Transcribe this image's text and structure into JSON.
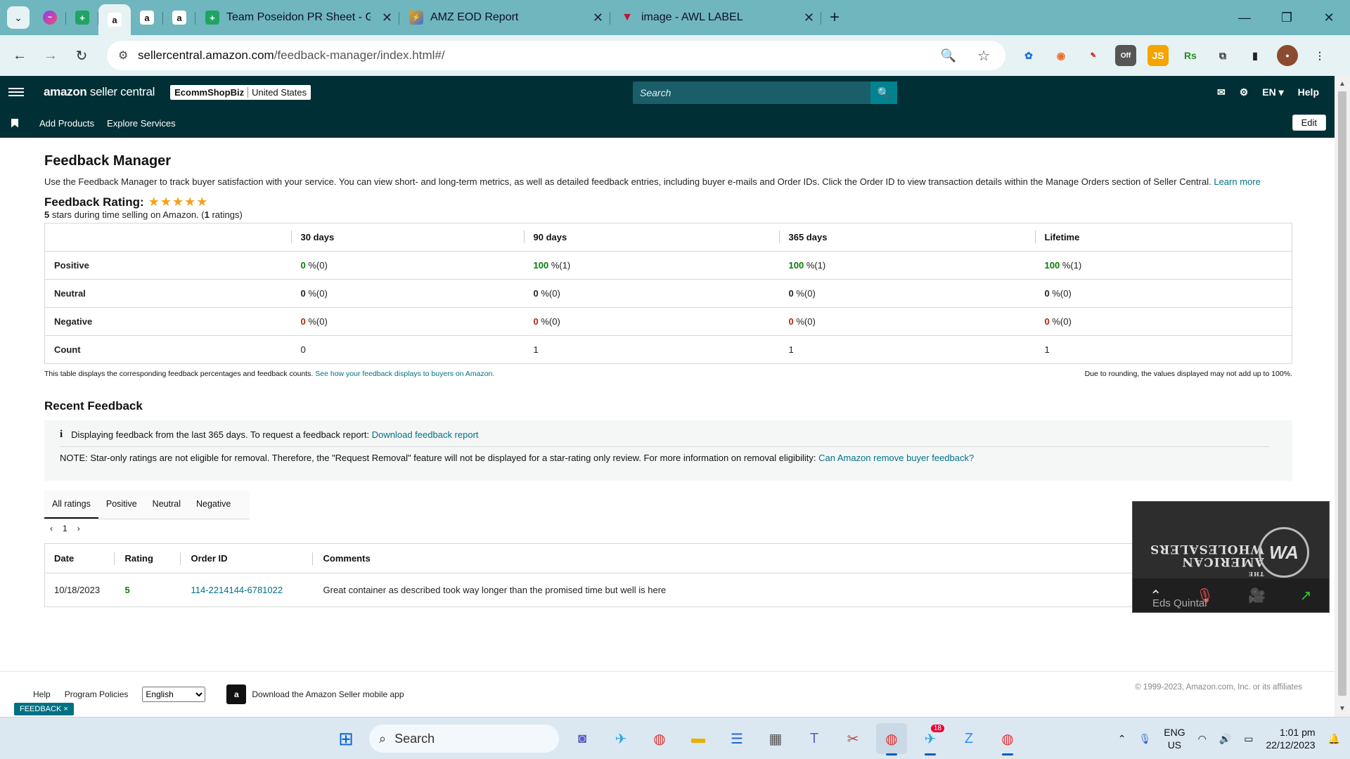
{
  "browser": {
    "tabs": [
      {
        "title": "Team Poseidon PR Sheet - Goo",
        "icon": "sheets-icon"
      },
      {
        "title": "AMZ EOD Report",
        "icon": "report-icon"
      },
      {
        "title": "image - AWL LABEL",
        "icon": "awl-icon"
      }
    ],
    "url_domain": "sellercentral.amazon.com",
    "url_path": "/feedback-manager/index.html#/"
  },
  "header": {
    "logo_bold": "amazon",
    "logo_rest": " seller central",
    "store_name": "EcommShopBiz",
    "store_region": "United States",
    "search_placeholder": "Search",
    "lang": "EN",
    "help": "Help"
  },
  "subnav": {
    "items": [
      "Add Products",
      "Explore Services"
    ],
    "edit": "Edit"
  },
  "page": {
    "title": "Feedback Manager",
    "intro": "Use the Feedback Manager to track buyer satisfaction with your service. You can view short- and long-term metrics, as well as detailed feedback entries, including buyer e-mails and Order IDs. Click the Order ID to view transaction details within the Manage Orders section of Seller Central.",
    "learn_more": "Learn more",
    "rating_label": "Feedback Rating:",
    "stars": "★★★★★",
    "rating_note_a": "5",
    "rating_note_b": " stars during time selling on Amazon. (",
    "rating_note_c": "1",
    "rating_note_d": " ratings)"
  },
  "summary_table": {
    "headers": [
      "30 days",
      "90 days",
      "365 days",
      "Lifetime"
    ],
    "rows": [
      {
        "label": "Positive",
        "cells": [
          [
            "0",
            " %(0)"
          ],
          [
            "100",
            " %(1)"
          ],
          [
            "100",
            " %(1)"
          ],
          [
            "100",
            " %(1)"
          ]
        ]
      },
      {
        "label": "Neutral",
        "cells": [
          [
            "0",
            " %(0)"
          ],
          [
            "0",
            " %(0)"
          ],
          [
            "0",
            " %(0)"
          ],
          [
            "0",
            " %(0)"
          ]
        ]
      },
      {
        "label": "Negative",
        "cells": [
          [
            "0",
            " %(0)"
          ],
          [
            "0",
            " %(0)"
          ],
          [
            "0",
            " %(0)"
          ],
          [
            "0",
            " %(0)"
          ]
        ]
      },
      {
        "label": "Count",
        "cells": [
          "0",
          "1",
          "1",
          "1"
        ]
      }
    ],
    "note_left": "This table displays the corresponding feedback percentages and feedback counts.",
    "note_link": "See how your feedback displays to buyers on Amazon.",
    "note_right": "Due to rounding, the values displayed may not add up to 100%."
  },
  "recent": {
    "title": "Recent Feedback",
    "info_text": "Displaying feedback from the last 365 days. To request a feedback report:",
    "info_link": "Download feedback report",
    "note_text": "NOTE: Star-only ratings are not eligible for removal. Therefore, the \"Request Removal\" feature will not be displayed for a star-rating only review. For more information on removal eligibility:",
    "note_link": "Can Amazon remove buyer feedback?",
    "tabs": [
      "All ratings",
      "Positive",
      "Neutral",
      "Negative"
    ],
    "page": "1",
    "columns": [
      "Date",
      "Rating",
      "Order ID",
      "Comments"
    ],
    "rows": [
      {
        "date": "10/18/2023",
        "rating": "5",
        "order_id": "114-2214144-6781022",
        "comment": "Great container as described took way longer than the promised time but well is here"
      }
    ]
  },
  "video": {
    "wm_line1": "THE",
    "wm_line2": "AMERICAN",
    "wm_line3": "WHOLESALERS",
    "badge": "WA",
    "participant": "Eds Quintal"
  },
  "footer": {
    "help": "Help",
    "policies": "Program Policies",
    "language": "English",
    "app_text": "Download the Amazon Seller mobile app",
    "copyright": "© 1999-2023, Amazon.com, Inc. or its affiliates",
    "chip": "FEEDBACK ×"
  },
  "taskbar": {
    "search": "Search",
    "lang1": "ENG",
    "lang2": "US",
    "time": "1:01 pm",
    "date": "22/12/2023",
    "telegram_badge": "18"
  },
  "colors": {
    "positive": "#067d06",
    "negative": "#b12704",
    "link": "#007185",
    "header_bg": "#002f36"
  }
}
